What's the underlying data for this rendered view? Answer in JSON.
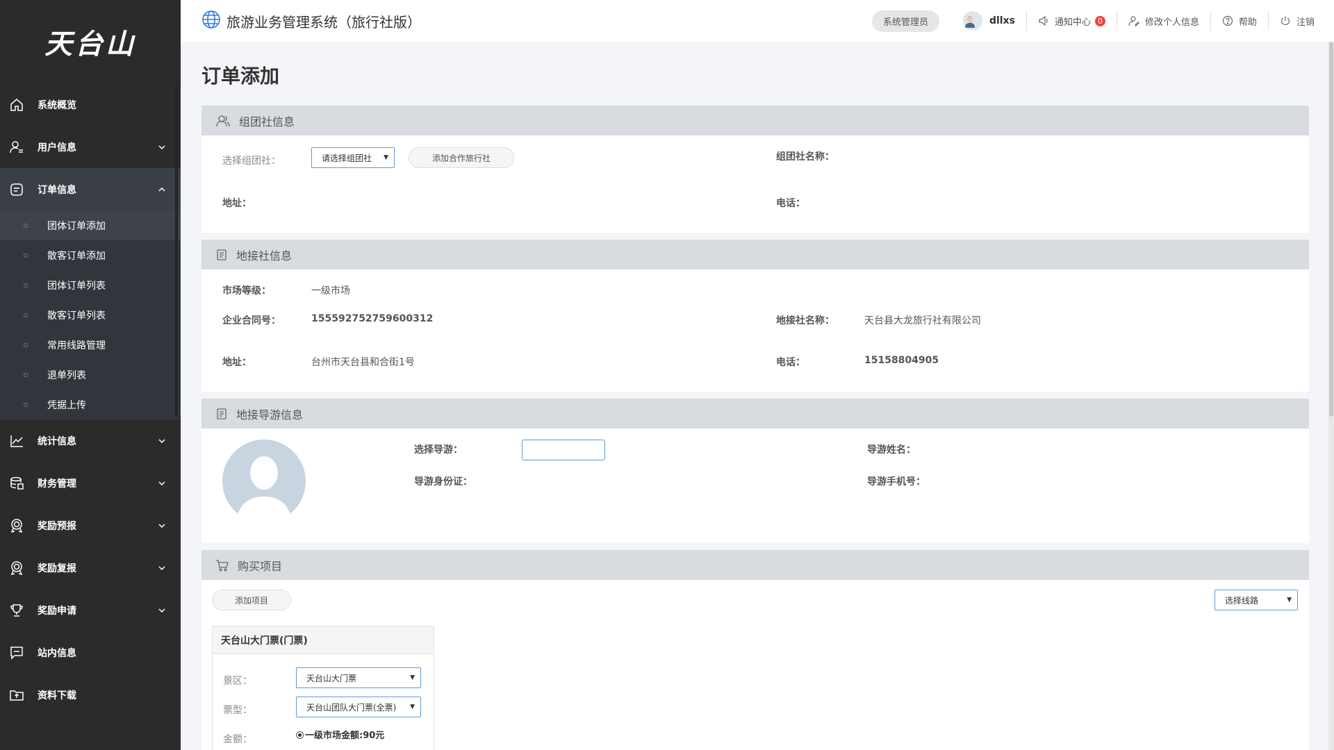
{
  "sidebar": {
    "logo": "天台山",
    "nav": [
      {
        "label": "系统概览"
      },
      {
        "label": "用户信息"
      },
      {
        "label": "订单信息"
      },
      {
        "label": "统计信息"
      },
      {
        "label": "财务管理"
      },
      {
        "label": "奖励预报"
      },
      {
        "label": "奖励复报"
      },
      {
        "label": "奖励申请"
      },
      {
        "label": "站内信息"
      },
      {
        "label": "资料下载"
      }
    ],
    "sub_items": [
      {
        "label": "团体订单添加"
      },
      {
        "label": "散客订单添加"
      },
      {
        "label": "团体订单列表"
      },
      {
        "label": "散客订单列表"
      },
      {
        "label": "常用线路管理"
      },
      {
        "label": "退单列表"
      },
      {
        "label": "凭据上传"
      }
    ]
  },
  "header": {
    "title": "旅游业务管理系统（旅行社版）",
    "role": "系统管理员",
    "username": "dllxs",
    "notifications_label": "通知中心",
    "notifications_count": "0",
    "edit_profile": "修改个人信息",
    "help": "帮助",
    "logout": "注销"
  },
  "page_title": "订单添加",
  "group_agency": {
    "title": "组团社信息",
    "select_label": "选择组团社：",
    "select_value": "请选择组团社",
    "add_button": "添加合作旅行社",
    "name_label": "组团社名称：",
    "address_label": "地址：",
    "phone_label": "电话："
  },
  "local_agency": {
    "title": "地接社信息",
    "market_label": "市场等级：",
    "market_value": "一级市场",
    "contract_label": "企业合同号：",
    "contract_value": "155592752759600312",
    "name_label": "地接社名称：",
    "name_value": "天台县大龙旅行社有限公司",
    "address_label": "地址：",
    "address_value": "台州市天台县和合街1号",
    "phone_label": "电话：",
    "phone_value": "15158804905"
  },
  "guide": {
    "title": "地接导游信息",
    "select_label": "选择导游：",
    "name_label": "导游姓名：",
    "id_label": "导游身份证：",
    "mobile_label": "导游手机号："
  },
  "purchase": {
    "title": "购买项目",
    "add_button": "添加项目",
    "route_select": "选择线路",
    "item": {
      "title": "天台山大门票(门票)",
      "scenic_label": "景区：",
      "scenic_value": "天台山大门票",
      "ticket_label": "票型：",
      "ticket_value": "天台山团队大门票(全票)",
      "amount_label": "金额：",
      "amount_value": "一级市场金额:90元"
    }
  }
}
